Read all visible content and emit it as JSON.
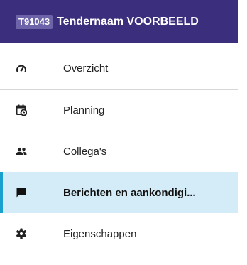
{
  "header": {
    "tender_code": "T91043",
    "tender_name": "Tendernaam VOORBEELD"
  },
  "nav": {
    "items": [
      {
        "label": "Overzicht",
        "icon": "speedometer-icon",
        "active": false
      },
      {
        "label": "Planning",
        "icon": "calendar-clock-icon",
        "active": false
      },
      {
        "label": "Collega's",
        "icon": "people-icon",
        "active": false
      },
      {
        "label": "Berichten en aankondigi...",
        "icon": "message-icon",
        "active": true
      },
      {
        "label": "Eigenschappen",
        "icon": "gear-icon",
        "active": false
      }
    ]
  },
  "colors": {
    "header_bg": "#3b2f7d",
    "active_bg": "#d4ecf7",
    "active_accent": "#1aa0cf"
  }
}
